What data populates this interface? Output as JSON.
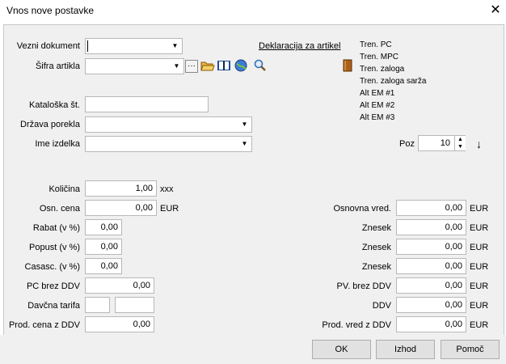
{
  "window": {
    "title": "Vnos nove postavke"
  },
  "header": {
    "vezni_label": "Vezni dokument",
    "sifra_label": "Šifra artikla",
    "deklaracija_link": "Deklaracija za artikel",
    "ellipsis": "···"
  },
  "info": {
    "tren_pc": "Tren. PC",
    "tren_mpc": "Tren. MPC",
    "tren_zaloga": "Tren. zaloga",
    "tren_zaloga_sarza": "Tren. zaloga sarža",
    "alt1": "Alt EM #1",
    "alt2": "Alt EM #2",
    "alt3": "Alt EM #3"
  },
  "fields": {
    "katalog_label": "Kataloška št.",
    "drzava_label": "Država porekla",
    "ime_label": "Ime izdelka",
    "poz_label": "Poz",
    "poz_value": "10",
    "kolicina_label": "Količina",
    "kolicina_value": "1,00",
    "kolicina_unit": "xxx",
    "osn_cena_label": "Osn. cena",
    "osn_cena_value": "0,00",
    "osn_cena_unit": "EUR",
    "rabat_label": "Rabat (v %)",
    "rabat_value": "0,00",
    "popust_label": "Popust (v %)",
    "popust_value": "0,00",
    "casasc_label": "Casasc. (v %)",
    "casasc_value": "0,00",
    "pc_brez_ddv_label": "PC brez DDV",
    "pc_brez_ddv_value": "0,00",
    "davcna_label": "Davčna tarifa",
    "prod_cena_label": "Prod. cena z DDV",
    "prod_cena_value": "0,00"
  },
  "right_fields": {
    "osnovna_label": "Osnovna vred.",
    "osnovna_value": "0,00",
    "znesek1_label": "Znesek",
    "znesek1_value": "0,00",
    "znesek2_label": "Znesek",
    "znesek2_value": "0,00",
    "znesek3_label": "Znesek",
    "znesek3_value": "0,00",
    "pv_brez_label": "PV. brez DDV",
    "pv_brez_value": "0,00",
    "ddv_label": "DDV",
    "ddv_value": "0,00",
    "prod_vred_label": "Prod. vred z DDV",
    "prod_vred_value": "0,00",
    "unit": "EUR"
  },
  "buttons": {
    "ok": "OK",
    "izhod": "Izhod",
    "pomoc": "Pomoč"
  }
}
